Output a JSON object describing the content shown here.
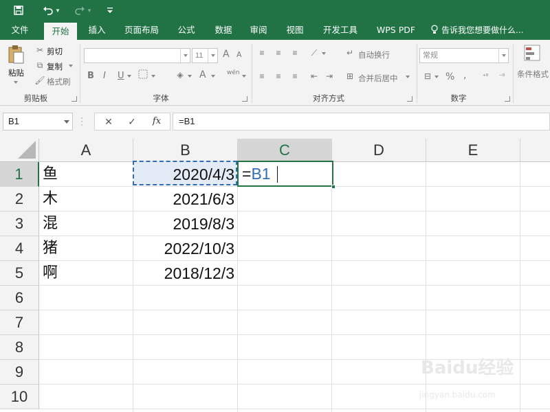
{
  "titlebar": {
    "save_icon": "save-icon",
    "undo_icon": "undo-icon",
    "redo_icon": "redo-icon",
    "customize_icon": "customize-icon"
  },
  "tabs": [
    {
      "label": "文件",
      "active": false
    },
    {
      "label": "开始",
      "active": true
    },
    {
      "label": "插入",
      "active": false
    },
    {
      "label": "页面布局",
      "active": false
    },
    {
      "label": "公式",
      "active": false
    },
    {
      "label": "数据",
      "active": false
    },
    {
      "label": "审阅",
      "active": false
    },
    {
      "label": "视图",
      "active": false
    },
    {
      "label": "开发工具",
      "active": false
    },
    {
      "label": "WPS PDF",
      "active": false
    }
  ],
  "tell_me": "告诉我您想要做什么...",
  "ribbon": {
    "clipboard": {
      "paste": "粘贴",
      "cut": "剪切",
      "copy": "复制",
      "format_painter": "格式刷",
      "group_label": "剪贴板"
    },
    "font": {
      "font_name": "",
      "font_size": "11",
      "bold": "B",
      "italic": "I",
      "underline": "U",
      "grow": "A",
      "shrink": "A",
      "font_color": "A",
      "phonetic": "wén",
      "group_label": "字体"
    },
    "alignment": {
      "wrap_text": "自动换行",
      "merge_center": "合并后居中",
      "group_label": "对齐方式"
    },
    "number": {
      "format": "常规",
      "percent": "%",
      "comma": ",",
      "group_label": "数字"
    },
    "styles": {
      "conditional_formatting": "条件格式"
    }
  },
  "formula_bar": {
    "name_box": "B1",
    "cancel_icon": "✕",
    "enter_icon": "✓",
    "fx_label": "fx",
    "formula": "=B1"
  },
  "grid": {
    "columns": [
      "A",
      "B",
      "C",
      "D",
      "E"
    ],
    "selected_column": "C",
    "rows": [
      "1",
      "2",
      "3",
      "4",
      "5",
      "6",
      "7",
      "8",
      "9",
      "10"
    ],
    "selected_row": "1",
    "column_a": [
      "鱼",
      "木",
      "混",
      "猪",
      "啊"
    ],
    "column_b": [
      "2020/4/3",
      "2021/6/3",
      "2019/8/3",
      "2022/10/3",
      "2018/12/3"
    ],
    "active_cell": {
      "address": "C1",
      "prefix": "=",
      "reference": "B1"
    }
  },
  "watermark": {
    "logo": "Baidu经验",
    "url": "jingyan.baidu.com"
  }
}
